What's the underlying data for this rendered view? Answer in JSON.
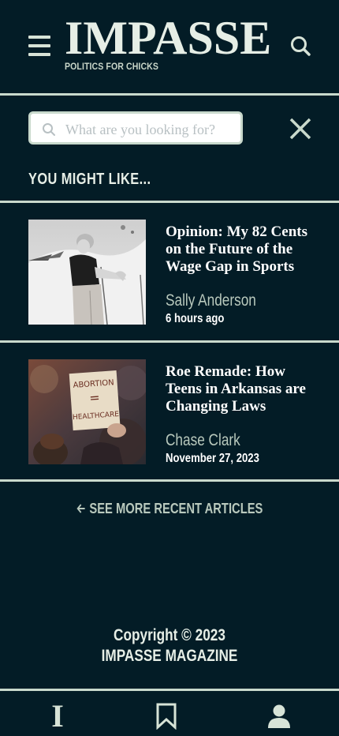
{
  "header": {
    "brand_name": "IMPASSE",
    "tagline": "POLITICS FOR CHICKS",
    "menu_icon": "hamburger-menu-icon",
    "search_icon": "search-icon"
  },
  "search": {
    "placeholder": "What are you looking for?",
    "value": "",
    "close_icon": "close-icon"
  },
  "section_title": "YOU MIGHT LIKE...",
  "articles": [
    {
      "title": "Opinion: My 82 Cents on the Future of the Wage Gap in Sports",
      "author": "Sally Anderson",
      "date": "6 hours ago"
    },
    {
      "title": "Roe Remade: How Teens in Arkansas are Changing Laws",
      "author": "Chase Clark",
      "date": "November 27, 2023",
      "sign_text": [
        "ABORTION",
        "=",
        "HEALTHCARE"
      ]
    }
  ],
  "see_more": "SEE MORE RECENT ARTICLES",
  "footer": {
    "copyright": "Copyright © 2023",
    "magazine": "IMPASSE MAGAZINE"
  },
  "bottom_nav": {
    "home_glyph": "I",
    "bookmark_icon": "bookmark-icon",
    "profile_icon": "profile-icon"
  },
  "colors": {
    "background": "#031c26",
    "accent": "#c9d9cc",
    "muted_text": "#b9c9bd"
  }
}
